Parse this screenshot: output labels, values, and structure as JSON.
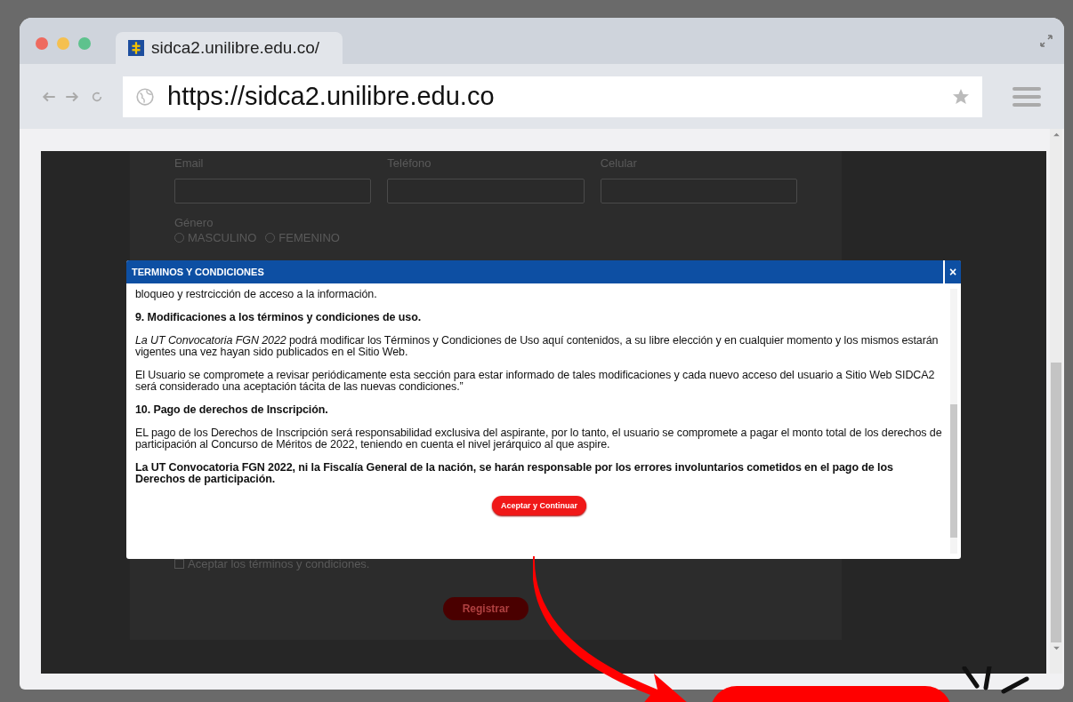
{
  "browser": {
    "tab_title": "sidca2.unilibre.edu.co/",
    "url": "https://sidca2.unilibre.edu.co"
  },
  "form": {
    "fields": [
      {
        "label": "Email"
      },
      {
        "label": "Teléfono"
      },
      {
        "label": "Celular"
      }
    ],
    "gender": {
      "label": "Género",
      "options": [
        {
          "label": "MASCULINO",
          "selected": false
        },
        {
          "label": "FEMENINO",
          "selected": false
        }
      ]
    },
    "terms_checkbox": {
      "label": "Aceptar los términos y condiciones.",
      "checked": false
    },
    "submit": "Registrar"
  },
  "modal": {
    "title": "TERMINOS Y CONDICIONES",
    "close": "×",
    "paragraphs": [
      {
        "kind": "text",
        "text": "bloqueo y restrcicción de acceso a la información."
      },
      {
        "kind": "heading",
        "text": "9. Modificaciones a los términos y condiciones de uso."
      },
      {
        "kind": "text",
        "text": "*La UT Convocatoria FGN 2022* podrá modificar los Términos y Condiciones de Uso aquí contenidos, a su libre elección y en cualquier momento y los mismos estarán vigentes una vez hayan sido publicados en el Sitio Web."
      },
      {
        "kind": "text",
        "text": "El Usuario se compromete a revisar periódicamente esta sección para estar informado de tales modificaciones y cada nuevo acceso del usuario a Sitio Web SIDCA2 será considerado una aceptación tácita de las nuevas condiciones.”"
      },
      {
        "kind": "heading",
        "text": "10. Pago de derechos de Inscripción."
      },
      {
        "kind": "text",
        "text": "EL pago de los Derechos de Inscripción será responsabilidad exclusiva del aspirante, por lo tanto, el usuario se compromete a pagar el monto total de los derechos de participación al Concurso de Méritos de 2022, teniendo en cuenta el nivel jerárquico al que aspire."
      },
      {
        "kind": "heading",
        "text": "La UT Convocatoria FGN 2022, ni la Fiscalía General de la nación, se harán responsable por los errores involuntarios cometidos en el pago de los Derechos de participación."
      }
    ],
    "button": "Aceptar y Continuar"
  }
}
